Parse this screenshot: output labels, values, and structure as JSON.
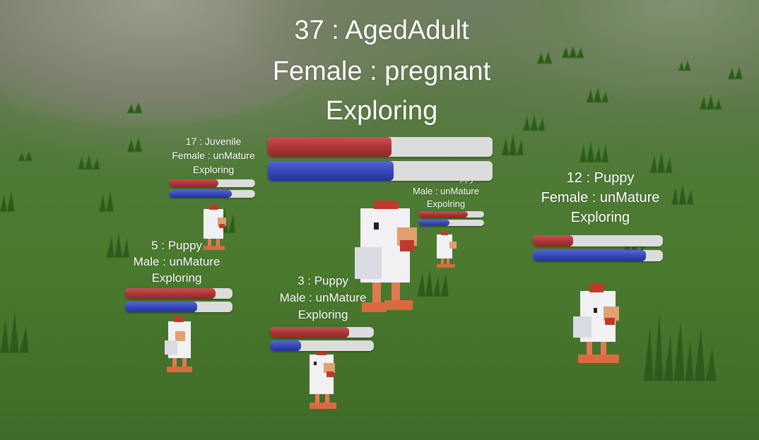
{
  "scene": {
    "type": "3d-simulation",
    "ground_color": "#4a7a2e",
    "sky_hill_color": "#7d8a6e"
  },
  "creatures": [
    {
      "id": "c37",
      "age_number": "37",
      "age_stage": "AgedAdult",
      "sex": "Female",
      "status": "pregnant",
      "activity": "Exploring",
      "line1": "37 : AgedAdult",
      "line2": "Female : pregnant",
      "line3": "Exploring",
      "bar_red": 0.55,
      "bar_blue": 0.56
    },
    {
      "id": "c17",
      "line1": "17 : Juvenile",
      "line2": "Female : unMature",
      "line3": "Exploring",
      "bar_red": 0.57,
      "bar_blue": 0.73
    },
    {
      "id": "c12",
      "line1": "12 : Puppy",
      "line2": "Female : unMature",
      "line3": "Exploring",
      "bar_red": 0.31,
      "bar_blue": 0.87
    },
    {
      "id": "c5",
      "line1": "5 : Puppy",
      "line2": "Male : unMature",
      "line3": "Exploring",
      "bar_red": 0.84,
      "bar_blue": 0.67
    },
    {
      "id": "c3",
      "line1": "3 : Puppy",
      "line2": "Male : unMature",
      "line3": "Exploring",
      "bar_red": 0.76,
      "bar_blue": 0.3
    },
    {
      "id": "cbg",
      "line1": "ppy",
      "line2": "Male : unMature",
      "line3": "Expolring",
      "bar_red": 0.75,
      "bar_blue": 0.47
    }
  ],
  "colors": {
    "hunger_bar": "#a83333",
    "energy_bar": "#3344b0",
    "bar_track": "#dcdcdc",
    "label_text": "#ffffff"
  }
}
